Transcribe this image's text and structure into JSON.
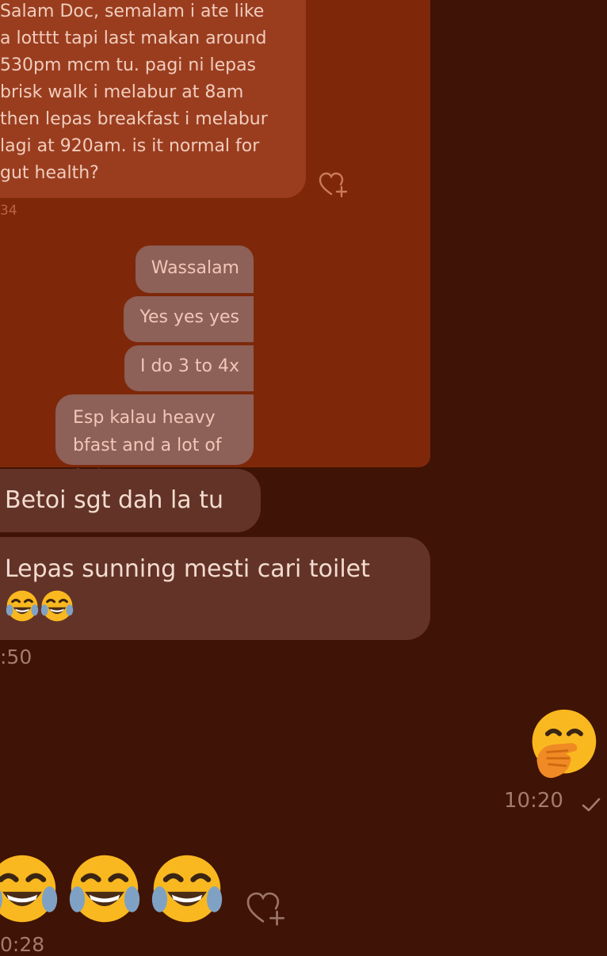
{
  "quoted_message": {
    "text": "Salam Doc, semalam i ate like\na lotttt tapi last makan around\n530pm mcm tu. pagi ni lepas\nbrisk walk i melabur at 8am\nthen lepas breakfast i melabur\nlagi at 920am. is it normal for\ngut health?",
    "time_fragment": "34"
  },
  "replies": [
    {
      "text": "Wassalam"
    },
    {
      "text": "Yes yes yes"
    },
    {
      "text": "I do 3 to 4x"
    },
    {
      "text": "Esp kalau heavy bfast and a lot of sun"
    }
  ],
  "messages": [
    {
      "text": "Betoi sgt dah la tu"
    },
    {
      "text": "Lepas sunning mesti cari toilet",
      "emoji": [
        "face-with-tears-of-joy",
        "face-with-tears-of-joy"
      ]
    }
  ],
  "time_left": ":50",
  "sent_emoji": {
    "emoji": "face-with-hand-over-mouth",
    "time": "10:20",
    "status": "check-icon"
  },
  "received_emoji": {
    "emoji": [
      "face-with-tears-of-joy",
      "face-with-tears-of-joy",
      "face-with-tears-of-joy"
    ],
    "time_fragment": "0:28"
  },
  "colors": {
    "background": "#3f1305",
    "quoted_panel": "#7e2809",
    "reply_bubble": "#8d6058",
    "incoming_bubble": "#633327"
  }
}
